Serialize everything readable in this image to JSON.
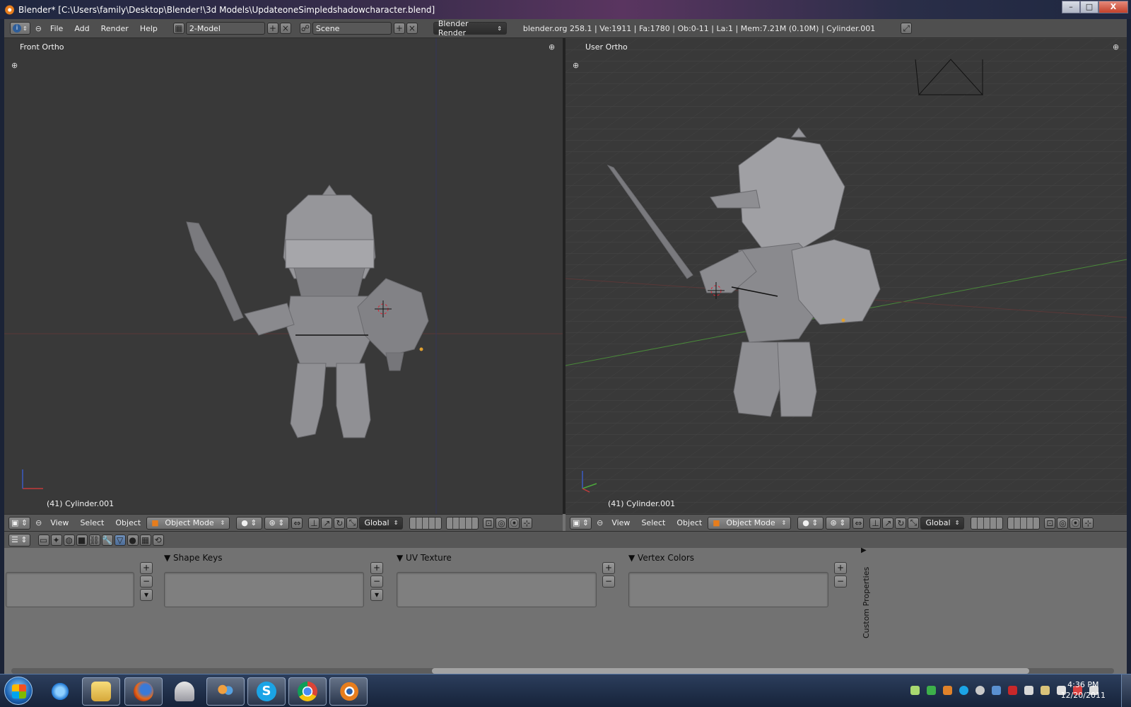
{
  "window": {
    "title": "Blender* [C:\\Users\\family\\Desktop\\Blender!\\3d Models\\UpdateoneSimpledshadowcharacter.blend]",
    "minimize": "–",
    "maximize": "□",
    "close": "X"
  },
  "info_header": {
    "menus": [
      "File",
      "Add",
      "Render",
      "Help"
    ],
    "layout": "2-Model",
    "scene": "Scene",
    "engine": "Blender Render",
    "stats": "blender.org 258.1 | Ve:1911 | Fa:1780 | Ob:0-11 | La:1 | Mem:7.21M (0.10M) | Cylinder.001"
  },
  "viewports": {
    "left": {
      "label": "Front Ortho",
      "object": "(41) Cylinder.001"
    },
    "right": {
      "label": "User Ortho",
      "object": "(41) Cylinder.001"
    }
  },
  "viewport_header": {
    "menus": [
      "View",
      "Select",
      "Object"
    ],
    "mode": "Object Mode",
    "orientation": "Global"
  },
  "properties": {
    "panels": [
      "Shape Keys",
      "UV Texture",
      "Vertex Colors"
    ],
    "custom_properties": "Custom Properties"
  },
  "taskbar": {
    "apps": [
      "internet-explorer",
      "file-explorer",
      "firefox",
      "installer",
      "people",
      "skype",
      "chrome",
      "blender"
    ],
    "time": "4:36 PM",
    "date": "12/20/2011"
  },
  "colors": {
    "accent_orange": "#e77d1c",
    "viewport_bg": "#393939",
    "x_axis": "#b33a3a",
    "y_axis": "#4ca83c"
  }
}
